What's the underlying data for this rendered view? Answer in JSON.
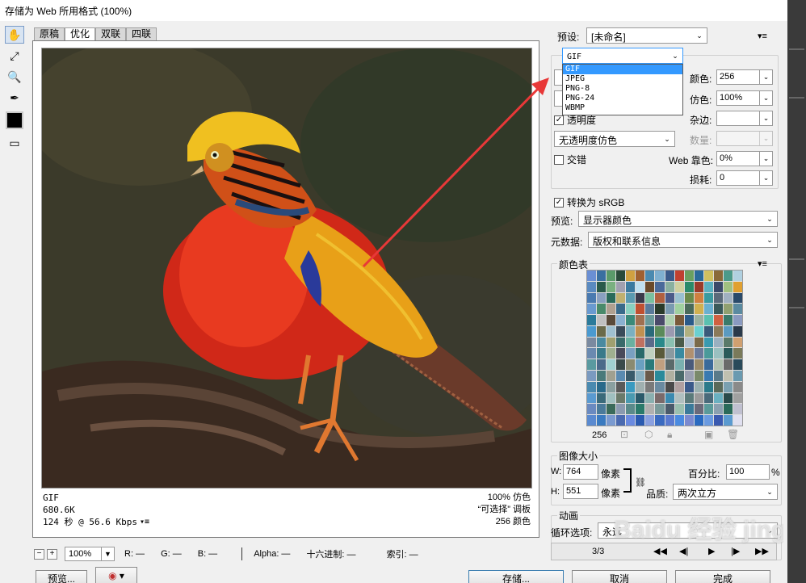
{
  "window": {
    "title": "存储为 Web 所用格式 (100%)"
  },
  "tabs": [
    "原稿",
    "优化",
    "双联",
    "四联"
  ],
  "selected_tab": 1,
  "image_info": {
    "format": "GIF",
    "size": "680.6K",
    "time": "124 秒 @ 56.6 Kbps",
    "dither": "100% 仿色",
    "reduction": "“可选择” 调板",
    "colors": "256 颜色"
  },
  "statusbar": {
    "zoom": "100%",
    "r": "R: —",
    "g": "G: —",
    "b": "B: —",
    "alpha": "Alpha: —",
    "hex": "十六进制: —",
    "index": "索引: —"
  },
  "buttons": {
    "preview": "预览...",
    "save": "存储...",
    "cancel": "取消",
    "done": "完成"
  },
  "settings": {
    "preset_label": "预设:",
    "preset_value": "[未命名]",
    "format_value": "GIF",
    "format_options": [
      "GIF",
      "JPEG",
      "PNG-8",
      "PNG-24",
      "WBMP"
    ],
    "colors_label": "颜色:",
    "colors_value": "256",
    "dither_label": "仿色:",
    "dither_value": "100%",
    "transparency_label": "透明度",
    "matte_label": "杂边:",
    "transparency_dither": "无透明度仿色",
    "amount_label": "数量:",
    "interlaced_label": "交错",
    "websnap_label": "Web 靠色:",
    "websnap_value": "0%",
    "lossy_label": "损耗:",
    "lossy_value": "0",
    "convert_srgb": "转换为 sRGB",
    "preview_label": "预览:",
    "preview_value": "显示器颜色",
    "metadata_label": "元数据:",
    "metadata_value": "版权和联系信息"
  },
  "color_table": {
    "title": "颜色表",
    "count": "256",
    "colors": [
      "#6a8fd4",
      "#3a6fa0",
      "#5a9a6a",
      "#2a4a3a",
      "#d0a040",
      "#a06030",
      "#4a8ab0",
      "#7fb0d0",
      "#3a5a8a",
      "#c04030",
      "#6aa060",
      "#2a6a9a",
      "#d0c060",
      "#8a6a3a",
      "#4a9a8a",
      "#b0d0e0",
      "#5a8ac0",
      "#2a5a4a",
      "#7ab080",
      "#a0a0b0",
      "#3a7aa0",
      "#c0e0f0",
      "#6a4a2a",
      "#4a6a9a",
      "#8ab0a0",
      "#d0d0a0",
      "#2a8a6a",
      "#9a3a2a",
      "#5ab0c0",
      "#3a4a6a",
      "#a0c080",
      "#e0a030",
      "#4a7ab0",
      "#8aa0c0",
      "#2a6a5a",
      "#c0b070",
      "#5a9ab0",
      "#3a3a4a",
      "#7ac0a0",
      "#b06040",
      "#4a5a8a",
      "#9ac0d0",
      "#6a8a4a",
      "#d08040",
      "#3a9aa0",
      "#5a6a7a",
      "#a0b0c0",
      "#2a4a6a",
      "#6a9ad0",
      "#4a8a6a",
      "#b0a090",
      "#3a6a8a",
      "#8ad0c0",
      "#c05030",
      "#5a7a9a",
      "#2a3a2a",
      "#7a9ab0",
      "#a0d0a0",
      "#4a6a5a",
      "#d0b050",
      "#6ab0d0",
      "#3a5a5a",
      "#90a070",
      "#5a8aa0",
      "#2a7a9a",
      "#c0c0c0",
      "#5a4a3a",
      "#8ab0d0",
      "#3a8a7a",
      "#a07050",
      "#6a9a9a",
      "#4a4a6a",
      "#b0d0b0",
      "#7a5a3a",
      "#2a5a8a",
      "#9ab0a0",
      "#5ac0b0",
      "#d06040",
      "#3a7a6a",
      "#8a9ac0",
      "#4a9ad0",
      "#6a6a4a",
      "#a0c0d0",
      "#3a4a5a",
      "#7ab0c0",
      "#c09050",
      "#2a6a7a",
      "#5a8a5a",
      "#9a9ab0",
      "#4a7a8a",
      "#b0b080",
      "#6ad0d0",
      "#3a5a7a",
      "#8a7a5a",
      "#5a9ac0",
      "#2a3a4a",
      "#7a8aa0",
      "#4a8aa0",
      "#a0a070",
      "#3a6a6a",
      "#6ab0a0",
      "#c07060",
      "#5a6a8a",
      "#2a8a8a",
      "#8ac0b0",
      "#4a5a4a",
      "#b0c0d0",
      "#7a6a4a",
      "#3a9ab0",
      "#9ab0c0",
      "#5a7a6a",
      "#d0a070",
      "#6a8ab0",
      "#3a7a8a",
      "#a0b090",
      "#4a4a5a",
      "#7aa0c0",
      "#2a6a6a",
      "#c0d0c0",
      "#5a5a3a",
      "#8a9aa0",
      "#3a8aa0",
      "#b09070",
      "#6a7a9a",
      "#4a9a9a",
      "#9ac0c0",
      "#2a5a5a",
      "#7a7a5a",
      "#5a9aa0",
      "#4a6a8a",
      "#a0d0d0",
      "#3a4a4a",
      "#8a8a70",
      "#6aa0c0",
      "#2a7a7a",
      "#c0a080",
      "#5a6a6a",
      "#7ab0b0",
      "#4a5a7a",
      "#9a8a6a",
      "#3a6a9a",
      "#b0c0b0",
      "#6a6a6a",
      "#2a4a5a",
      "#7a9ac0",
      "#4a7a7a",
      "#a0a090",
      "#5a8ab0",
      "#3a5a6a",
      "#8ab0c0",
      "#6a5a4a",
      "#2a8a9a",
      "#b0b0a0",
      "#4a6a6a",
      "#9aa0b0",
      "#7a8a6a",
      "#3a7ab0",
      "#5a7a8a",
      "#c0c0b0",
      "#6a9ab0",
      "#4a8ab0",
      "#2a6a8a",
      "#8aa0a0",
      "#5a5a5a",
      "#3a9ac0",
      "#a0b0b0",
      "#7a7a7a",
      "#6a8aa0",
      "#4a4a4a",
      "#b0a0a0",
      "#3a5a8a",
      "#9ab0b0",
      "#2a7a8a",
      "#5a6a5a",
      "#7aa0b0",
      "#8a8a8a",
      "#5a9ad0",
      "#3a6a7a",
      "#a0c0c0",
      "#6a7a6a",
      "#4a9ab0",
      "#2a5a6a",
      "#8ab0b0",
      "#7a6a6a",
      "#3a8ab0",
      "#b0c0c0",
      "#5a7a7a",
      "#9a9a9a",
      "#4a6a7a",
      "#6ab0c0",
      "#2a4a4a",
      "#a0a0a0",
      "#6a8ac0",
      "#4a7a9a",
      "#3a6a5a",
      "#8a9ab0",
      "#5a8a8a",
      "#2a7a6a",
      "#b0b0b0",
      "#7a9a9a",
      "#4a5a6a",
      "#9ac0b0",
      "#3a7a9a",
      "#6a6a7a",
      "#5a9a9a",
      "#8aa0b0",
      "#2a6a5a",
      "#c0c0d0",
      "#5a8ad0",
      "#3a7ac0",
      "#7a9ad0",
      "#4a6ab0",
      "#6a8ae0",
      "#2a5ab0",
      "#8aa0e0",
      "#3a6ac0",
      "#5a7ad0",
      "#4a8ae0",
      "#7a8ad0",
      "#2a6ac0",
      "#6a9ae0",
      "#3a5ab0",
      "#5a9ad0",
      "#e0e0f0"
    ]
  },
  "image_size": {
    "title": "图像大小",
    "w_label": "W:",
    "w_value": "764",
    "h_label": "H:",
    "h_value": "551",
    "unit": "像素",
    "percent_label": "百分比:",
    "percent_value": "100",
    "percent_unit": "%",
    "quality_label": "品质:",
    "quality_value": "两次立方"
  },
  "animation": {
    "title": "动画",
    "loop_label": "循环选项:",
    "loop_value": "永远",
    "frame": "3/3"
  },
  "watermark": "Baidu 经验 jingyan.baidu.com"
}
